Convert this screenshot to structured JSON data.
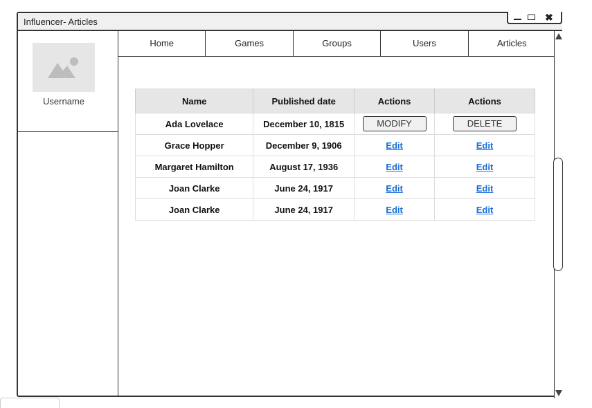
{
  "window": {
    "title": "Influencer- Articles",
    "controls": {
      "close_label": "✖"
    }
  },
  "sidebar": {
    "avatar_icon": "image-placeholder-icon",
    "username": "Username"
  },
  "nav": {
    "items": [
      {
        "label": "Home"
      },
      {
        "label": "Games"
      },
      {
        "label": "Groups"
      },
      {
        "label": "Users"
      },
      {
        "label": "Articles"
      }
    ]
  },
  "table": {
    "headers": [
      "Name",
      "Published date",
      "Actions",
      "Actions"
    ],
    "rows": [
      {
        "name": "Ada Lovelace",
        "date": "December 10, 1815",
        "action1": "MODIFY",
        "action2": "DELETE"
      },
      {
        "name": "Grace Hopper",
        "date": "December 9, 1906",
        "action1": "Edit",
        "action2": "Edit"
      },
      {
        "name": "Margaret Hamilton",
        "date": "August 17, 1936",
        "action1": "Edit",
        "action2": "Edit"
      },
      {
        "name": "Joan Clarke",
        "date": "June 24, 1917",
        "action1": "Edit",
        "action2": "Edit"
      },
      {
        "name": "Joan Clarke",
        "date": "June 24, 1917",
        "action1": "Edit",
        "action2": "Edit"
      }
    ]
  },
  "colors": {
    "link": "#1a6fd6",
    "header_bg": "#e6e6e6",
    "avatar_bg": "#e6e6e6"
  }
}
